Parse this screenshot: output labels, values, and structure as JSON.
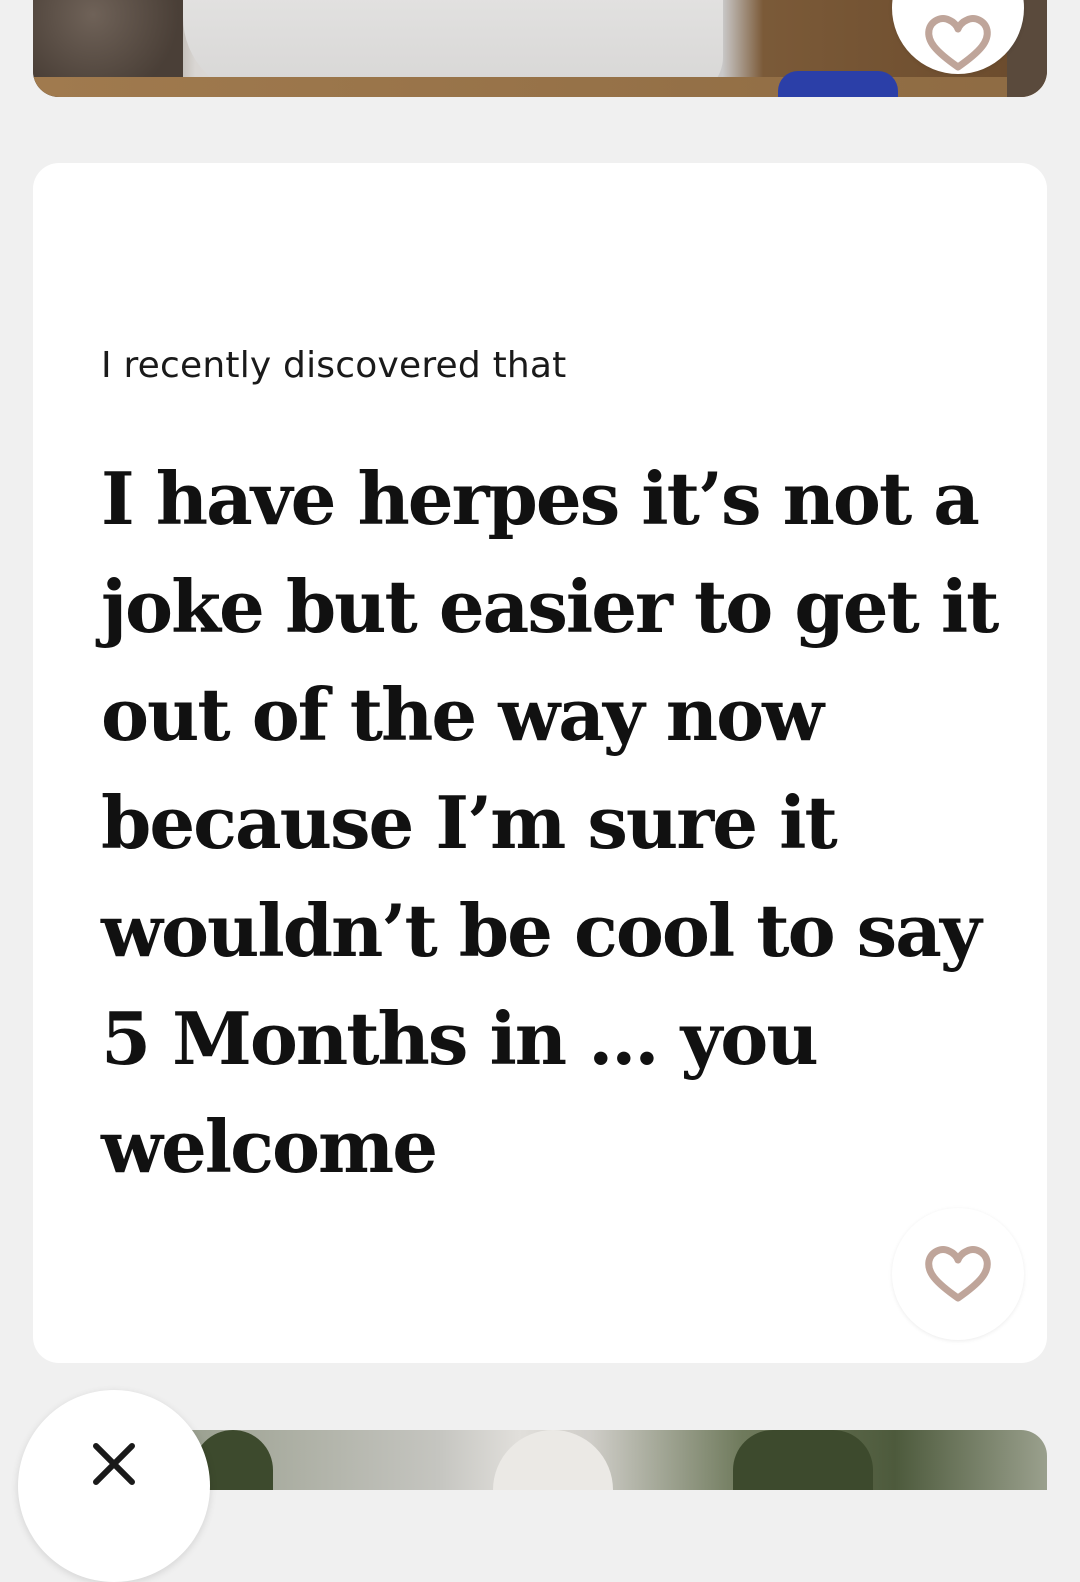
{
  "feed": {
    "photo_card_top": {
      "description_icon": "photo"
    },
    "prompt_card": {
      "question": "I recently discovered that",
      "answer": "I have herpes it’s not a joke but easier to get it out of the way now because I’m sure it wouldn’t be cool to say 5 Months in ... you welcome"
    },
    "buttons": {
      "like_icon": "heart-outline-icon",
      "skip_icon": "close-x-icon"
    }
  },
  "colors": {
    "background": "#f0f0f0",
    "card": "#ffffff",
    "heart_stroke": "#bfa59a",
    "text_primary": "#111111"
  }
}
